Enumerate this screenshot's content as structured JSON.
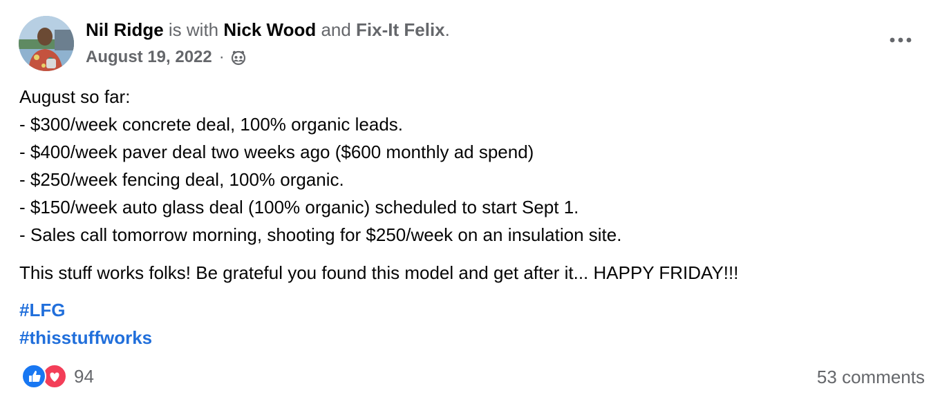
{
  "post": {
    "author": "Nil Ridge",
    "with_text": " is with ",
    "tagged_person": "Nick Wood",
    "and_text": " and ",
    "tagged_page": "Fix-It Felix",
    "end_period": ".",
    "date": "August 19, 2022",
    "separator": "·",
    "audience_icon": "friends-icon",
    "more_icon": "more-options-icon",
    "lines": [
      "August so far:",
      "- $300/week concrete deal, 100% organic leads.",
      "- $400/week paver deal two weeks ago ($600 monthly ad spend)",
      "- $250/week fencing deal, 100% organic.",
      "- $150/week auto glass deal (100% organic) scheduled to start Sept 1.",
      "- Sales call tomorrow morning, shooting for $250/week on an insulation site."
    ],
    "paragraph2": "This stuff works folks! Be grateful you found this model and get after it... HAPPY FRIDAY!!!",
    "hashtags": [
      "#LFG",
      "#thisstuffworks"
    ]
  },
  "footer": {
    "reaction_icons": [
      "like-icon",
      "love-icon"
    ],
    "reaction_count": "94",
    "comments": "53 comments"
  },
  "colors": {
    "text": "#050505",
    "muted": "#65676b",
    "link": "#216fdb",
    "like": "#1877f2",
    "love": "#f33e58"
  }
}
